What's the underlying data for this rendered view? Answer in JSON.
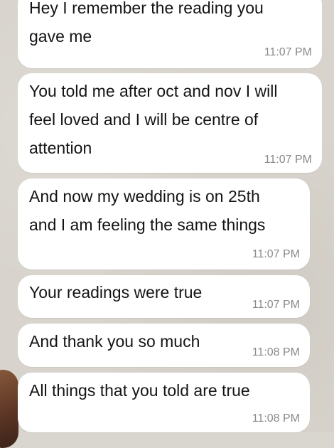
{
  "messages": [
    {
      "text": "Hey I remember the reading you\ngave me",
      "time": "11:07 PM"
    },
    {
      "text": "You told me after oct and nov I will\nfeel loved and I will be centre of\nattention",
      "time": "11:07 PM"
    },
    {
      "text": "And now my wedding is on 25th\nand I am feeling the same things",
      "time": "11:07 PM"
    },
    {
      "text": "Your readings were true",
      "time": "11:07 PM"
    },
    {
      "text": "And thank you so much",
      "time": "11:08 PM"
    },
    {
      "text": "All things that you told are true",
      "time": "11:08 PM"
    }
  ]
}
